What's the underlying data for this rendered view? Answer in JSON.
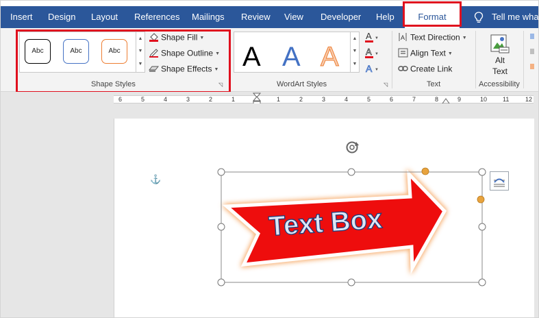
{
  "tabs": [
    {
      "label": "Insert",
      "active": false
    },
    {
      "label": "Design",
      "active": false
    },
    {
      "label": "Layout",
      "active": false
    },
    {
      "label": "References",
      "active": false
    },
    {
      "label": "Mailings",
      "active": false
    },
    {
      "label": "Review",
      "active": false
    },
    {
      "label": "View",
      "active": false
    },
    {
      "label": "Developer",
      "active": false
    },
    {
      "label": "Help",
      "active": false
    },
    {
      "label": "Format",
      "active": true
    }
  ],
  "tell_me": "Tell me wha",
  "colors": {
    "ribbon_blue": "#2b579a",
    "highlight_red": "#e0101e",
    "shape_red": "#ee0a10"
  },
  "shape_styles": {
    "label": "Shape Styles",
    "thumbnail_text": "Abc",
    "thumbnails": [
      {
        "border": "#000000"
      },
      {
        "border": "#4472c4"
      },
      {
        "border": "#ed7d31"
      }
    ],
    "commands": [
      {
        "label": "Shape Fill",
        "icon": "paint-bucket-icon"
      },
      {
        "label": "Shape Outline",
        "icon": "pencil-icon"
      },
      {
        "label": "Shape Effects",
        "icon": "shape-effects-icon"
      }
    ]
  },
  "wordart_styles": {
    "label": "WordArt Styles",
    "sample_letter": "A",
    "samples": [
      {
        "color": "#000000"
      },
      {
        "color": "#4472c4"
      },
      {
        "color": "#f4b183"
      }
    ]
  },
  "text_group": {
    "label": "Text",
    "commands": [
      {
        "label": "Text Direction",
        "icon": "text-direction-icon"
      },
      {
        "label": "Align Text",
        "icon": "align-text-icon"
      },
      {
        "label": "Create Link",
        "icon": "link-icon"
      }
    ]
  },
  "accessibility_group": {
    "label": "Accessibility",
    "alt_text_line1": "Alt",
    "alt_text_line2": "Text"
  },
  "ruler": {
    "labels": [
      "6",
      "5",
      "4",
      "3",
      "2",
      "1",
      "1",
      "2",
      "3",
      "4",
      "5",
      "6",
      "7",
      "8",
      "9",
      "10",
      "11",
      "12"
    ]
  },
  "document": {
    "shape_text": "Text Box"
  }
}
